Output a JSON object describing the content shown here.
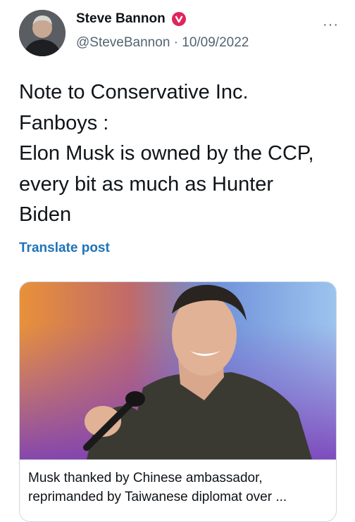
{
  "tweet": {
    "author_name": "Steve Bannon",
    "handle_date": "@SteveBannon · 10/09/2022",
    "more_label": "···",
    "lines": [
      "Note to Conservative Inc.",
      "Fanboys :",
      "Elon Musk is owned by the CCP,",
      "every bit as much as Hunter",
      "Biden"
    ],
    "translate_label": "Translate post"
  },
  "card": {
    "caption_lines": [
      "Musk thanked by Chinese ambassador,",
      "reprimanded by Taiwanese diplomat over ..."
    ]
  },
  "colors": {
    "badge": "#e0245e",
    "link": "#1d73b8",
    "muted": "#536471"
  },
  "icons": {
    "verified": "verified-badge-icon",
    "more": "more-icon"
  }
}
